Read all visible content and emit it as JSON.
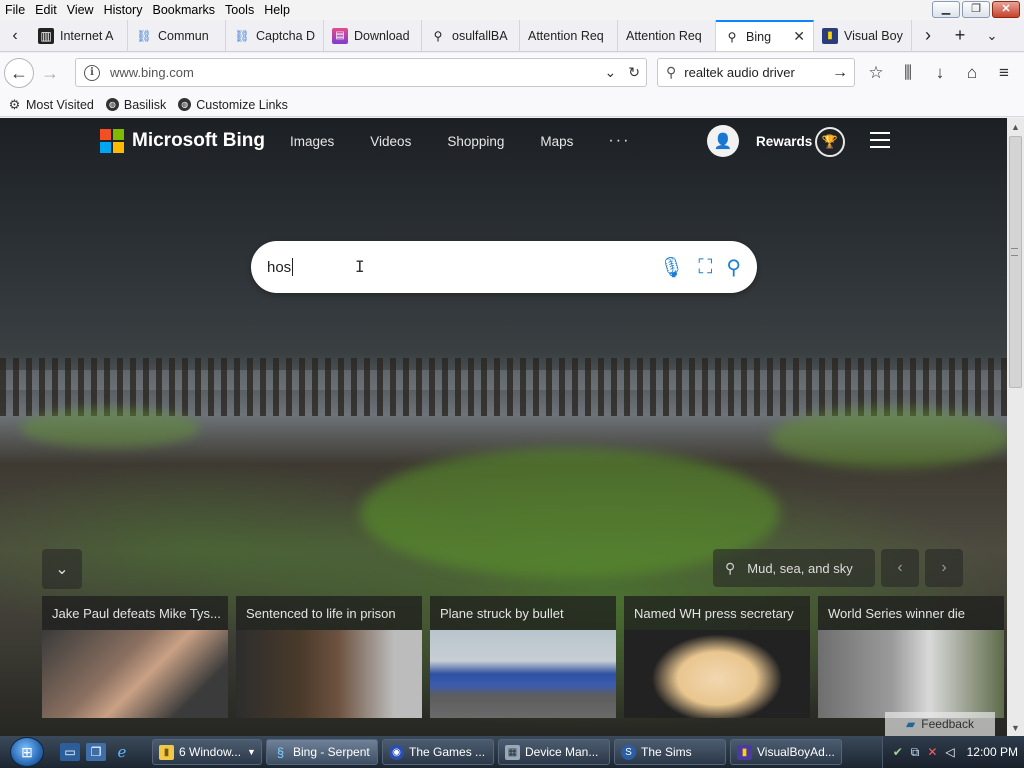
{
  "menubar": {
    "items": [
      "File",
      "Edit",
      "View",
      "History",
      "Bookmarks",
      "Tools",
      "Help"
    ]
  },
  "tabs": [
    {
      "label": "Internet A",
      "icon": "archive-icon"
    },
    {
      "label": "Commun",
      "icon": "network-icon"
    },
    {
      "label": "Captcha D",
      "icon": "network-icon"
    },
    {
      "label": "Download",
      "icon": "download-icon"
    },
    {
      "label": "osulfallBA",
      "icon": "search-icon"
    },
    {
      "label": "Attention Req",
      "icon": ""
    },
    {
      "label": "Attention Req",
      "icon": ""
    },
    {
      "label": "Bing",
      "icon": "search-icon",
      "active": true
    },
    {
      "label": "Visual Boy",
      "icon": "vba-icon"
    }
  ],
  "navbar": {
    "url": "www.bing.com",
    "search_value": "realtek audio driver"
  },
  "bookmarks": [
    {
      "label": "Most Visited",
      "icon": "gear-icon"
    },
    {
      "label": "Basilisk",
      "icon": "globe-icon"
    },
    {
      "label": "Customize Links",
      "icon": "globe-icon"
    }
  ],
  "bing": {
    "brand": "Microsoft Bing",
    "nav": [
      "Images",
      "Videos",
      "Shopping",
      "Maps"
    ],
    "more": "···",
    "rewards": "Rewards",
    "query": "hos",
    "location": "Mud, sea, and sky",
    "feedback": "Feedback",
    "news": [
      {
        "title": "Jake Paul defeats Mike Tys..."
      },
      {
        "title": "Sentenced to life in prison"
      },
      {
        "title": "Plane struck by bullet"
      },
      {
        "title": "Named WH press secretary"
      },
      {
        "title": "World Series winner die"
      }
    ]
  },
  "taskbar": {
    "buttons": [
      {
        "label": "6 Window...",
        "icon": "folder-icon"
      },
      {
        "label": "Bing - Serpent",
        "icon": "serpent-icon",
        "active": true
      },
      {
        "label": "The Games ...",
        "icon": "games-icon"
      },
      {
        "label": "Device Man...",
        "icon": "device-manager-icon"
      },
      {
        "label": "The Sims",
        "icon": "sims-icon"
      },
      {
        "label": "VisualBoyAd...",
        "icon": "vba-icon"
      }
    ],
    "clock": "12:00 PM"
  },
  "colors": {
    "accent_blue": "#0a84ff",
    "bing_blue": "#1e7fd0",
    "ms_red": "#f25022",
    "ms_green": "#7fba00",
    "ms_blue": "#00a4ef",
    "ms_yellow": "#ffb900"
  }
}
